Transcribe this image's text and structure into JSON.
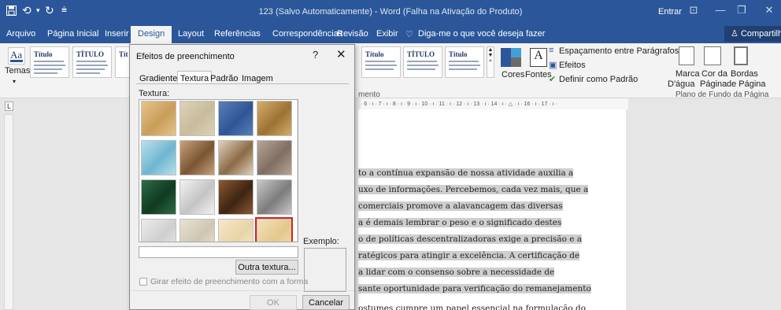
{
  "titlebar": {
    "doc_title": "123 (Salvo Automaticamente) - Word (Falha na Ativação do Produto)",
    "sign_in": "Entrar",
    "icons": [
      "save-icon",
      "undo-icon",
      "redo-icon",
      "customize-qat-icon",
      "ribbon-display-icon",
      "minimize-icon",
      "restore-icon",
      "close-icon"
    ]
  },
  "tabs": [
    "Arquivo",
    "Página Inicial",
    "Inserir",
    "Design",
    "Layout",
    "Referências",
    "Correspondências",
    "Revisão",
    "Exibir"
  ],
  "active_tab": "Design",
  "tell_me": "Diga-me o que você deseja fazer",
  "share": "Compartilhar",
  "ribbon": {
    "themes_label": "Temas",
    "style_sets": [
      {
        "title": "Título",
        "subtitle": "Título 1"
      },
      {
        "title": "TÍTULO",
        "subtitle": "Título 1"
      },
      {
        "title": "Tít",
        "subtitle": "Título 1"
      }
    ],
    "style_sets_right": [
      {
        "title": "Título",
        "subtitle": ""
      },
      {
        "title": "TÍTULO",
        "subtitle": "TÍTULO 1"
      },
      {
        "title": "Título",
        "subtitle": "TÍTULO 1"
      }
    ],
    "colors": "Cores",
    "fonts": "Fontes",
    "paragraph_spacing": "Espaçamento entre Parágrafos",
    "effects": "Efeitos",
    "set_default": "Definir como Padrão",
    "watermark_1": "Marca",
    "watermark_2": "D'água",
    "page_color_1": "Cor da",
    "page_color_2": "Página",
    "page_borders_1": "Bordas",
    "page_borders_2": "de Página",
    "page_bg_group": "Plano de Fundo da Página",
    "formatting_group_partial": "mento"
  },
  "ruler": {
    "text": "· 6 · ı · 7 · ı · 8 · ı · 9 · ı · 10 · ı · 11 · ı · 12 · ı · 13 · ı · 14 · ı · △ · ı · 16 · ı · 17 · ı ·",
    "corner": "L"
  },
  "document_lines": [
    {
      "text": "to a contínua expansão de nossa atividade auxilia a",
      "hl": true
    },
    {
      "text": "uxo de informações. Percebemos, cada vez mais, que a",
      "hl": true
    },
    {
      "text": "comerciais promove a alavancagem das diversas",
      "hl": true
    },
    {
      "text": "a é demais lembrar o peso e o significado destes",
      "hl": true
    },
    {
      "text": "o de políticas descentralizadoras exige a precisão e a",
      "hl": true
    },
    {
      "text": "ratégicos para atingir a excelência. A certificação de",
      "hl": true
    },
    {
      "text": "a lidar com o consenso sobre a necessidade de",
      "hl": true
    },
    {
      "text": "sante oportunidade para verificação do remanejamento",
      "hl": true
    },
    {
      "text": "ostumes cumpre um papel essencial na formulação do",
      "hl": false
    }
  ],
  "dialog": {
    "title": "Efeitos de preenchimento",
    "help": "?",
    "close": "✕",
    "tabs": [
      "Gradiente",
      "Textura",
      "Padrão",
      "Imagem"
    ],
    "selected_tab": "Textura",
    "texture_label": "Textura:",
    "textures": [
      {
        "name": "texture-papyrus",
        "c1": "#e6c48a",
        "c2": "#c99d5a"
      },
      {
        "name": "texture-canvas",
        "c1": "#dcd2b8",
        "c2": "#c8bc9c"
      },
      {
        "name": "texture-denim",
        "c1": "#5a7fb8",
        "c2": "#2f5596"
      },
      {
        "name": "texture-woven-mat",
        "c1": "#d6ae6a",
        "c2": "#9c7234"
      },
      {
        "name": "texture-water-droplets",
        "c1": "#b9e0ec",
        "c2": "#6fb6cf"
      },
      {
        "name": "texture-paper-bag",
        "c1": "#c9a27a",
        "c2": "#7a5534"
      },
      {
        "name": "texture-fish-fossil",
        "c1": "#e0d2bc",
        "c2": "#8c6a48"
      },
      {
        "name": "texture-sand",
        "c1": "#b8a596",
        "c2": "#7f6e62"
      },
      {
        "name": "texture-green-marble",
        "c1": "#2e6b46",
        "c2": "#103a22"
      },
      {
        "name": "texture-white-marble",
        "c1": "#f2f2f2",
        "c2": "#c4c4c4"
      },
      {
        "name": "texture-brown-marble",
        "c1": "#8a5a34",
        "c2": "#3e2412"
      },
      {
        "name": "texture-granite",
        "c1": "#c8c8c8",
        "c2": "#7c7c7c"
      },
      {
        "name": "texture-newsprint",
        "c1": "#ececec",
        "c2": "#cfcfcf"
      },
      {
        "name": "texture-recycled-paper",
        "c1": "#e8e2d4",
        "c2": "#cfc6b2"
      },
      {
        "name": "texture-parchment",
        "c1": "#f6e8c8",
        "c2": "#e8d4a8"
      },
      {
        "name": "texture-stationery",
        "c1": "#f3e1b8",
        "c2": "#e3c88e"
      }
    ],
    "selected_index": 15,
    "other_texture": "Outra textura...",
    "example_label": "Exemplo:",
    "rotate_label": "Girar efeito de preenchimento com a forma",
    "ok": "OK",
    "cancel": "Cancelar",
    "accent": "#d42222"
  }
}
